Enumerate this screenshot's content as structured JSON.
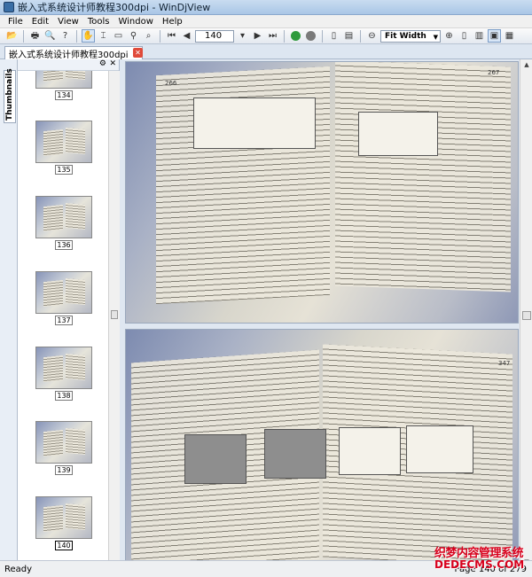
{
  "window": {
    "title": "嵌入式系统设计师教程300dpi - WinDjView"
  },
  "menu": [
    "File",
    "Edit",
    "View",
    "Tools",
    "Window",
    "Help"
  ],
  "toolbar": {
    "page_value": "140",
    "zoom_value": "Fit Width"
  },
  "document_tab": {
    "label": "嵌入式系统设计师教程300dpi"
  },
  "sidebar": {
    "tab_label": "Thumbnails",
    "thumbnails": [
      "134",
      "135",
      "136",
      "137",
      "138",
      "139",
      "140"
    ],
    "current": "140"
  },
  "pages": {
    "top_left_number": "266",
    "top_right_number": "267",
    "bottom_right_number": "347"
  },
  "status": {
    "left": "Ready",
    "right": "Page 140 of 279"
  },
  "watermark": {
    "line1": "织梦内容管理系统",
    "line2": "DEDECMS.COM"
  },
  "colors": {
    "accent": "#3a6ea5",
    "close": "#e04a3a",
    "watermark": "#d8001c"
  }
}
